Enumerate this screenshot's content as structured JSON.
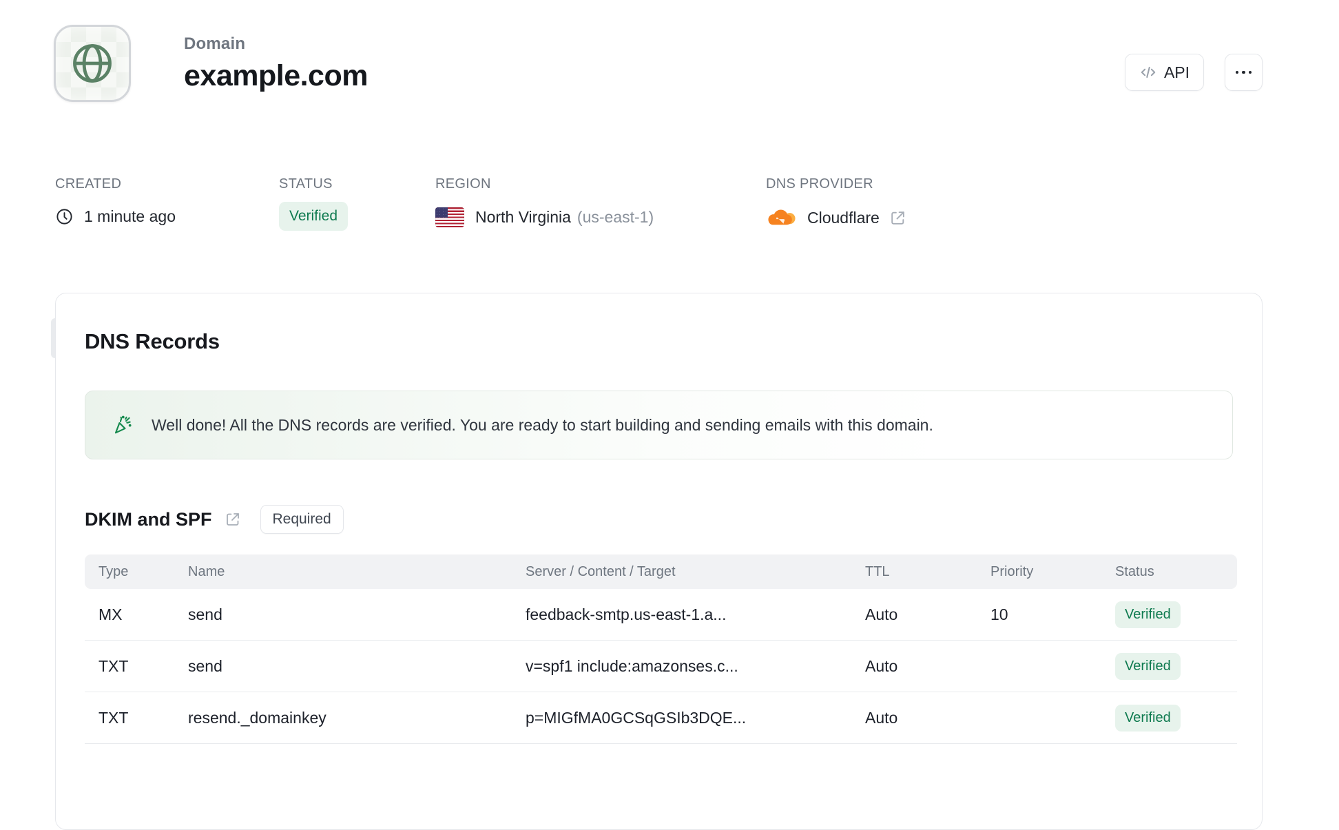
{
  "header": {
    "eyebrow": "Domain",
    "title": "example.com",
    "api_button": "API"
  },
  "meta": {
    "created": {
      "label": "CREATED",
      "value": "1 minute ago"
    },
    "status": {
      "label": "STATUS",
      "value": "Verified"
    },
    "region": {
      "label": "REGION",
      "value": "North Virginia",
      "code": "(us-east-1)"
    },
    "dns_provider": {
      "label": "DNS PROVIDER",
      "value": "Cloudflare"
    }
  },
  "dns_records": {
    "title": "DNS Records",
    "banner_text": "Well done! All the DNS records are verified. You are ready to start building and sending emails with this domain.",
    "section": {
      "title": "DKIM and SPF",
      "badge": "Required"
    },
    "table": {
      "headers": [
        "Type",
        "Name",
        "Server / Content / Target",
        "TTL",
        "Priority",
        "Status"
      ],
      "rows": [
        {
          "type": "MX",
          "name": "send",
          "content": "feedback-smtp.us-east-1.a...",
          "ttl": "Auto",
          "priority": "10",
          "status": "Verified"
        },
        {
          "type": "TXT",
          "name": "send",
          "content": "v=spf1 include:amazonses.c...",
          "ttl": "Auto",
          "priority": "",
          "status": "Verified"
        },
        {
          "type": "TXT",
          "name": "resend._domainkey",
          "content": "p=MIGfMA0GCSqGSIb3DQE...",
          "ttl": "Auto",
          "priority": "",
          "status": "Verified"
        }
      ]
    }
  },
  "colors": {
    "success_text": "#0e7a4f",
    "success_bg": "#e7f3ec",
    "globe_green": "#5b8266",
    "cloudflare_orange": "#f6821f",
    "cloudflare_light": "#fbad41",
    "border_gray": "#e6e8ec"
  }
}
